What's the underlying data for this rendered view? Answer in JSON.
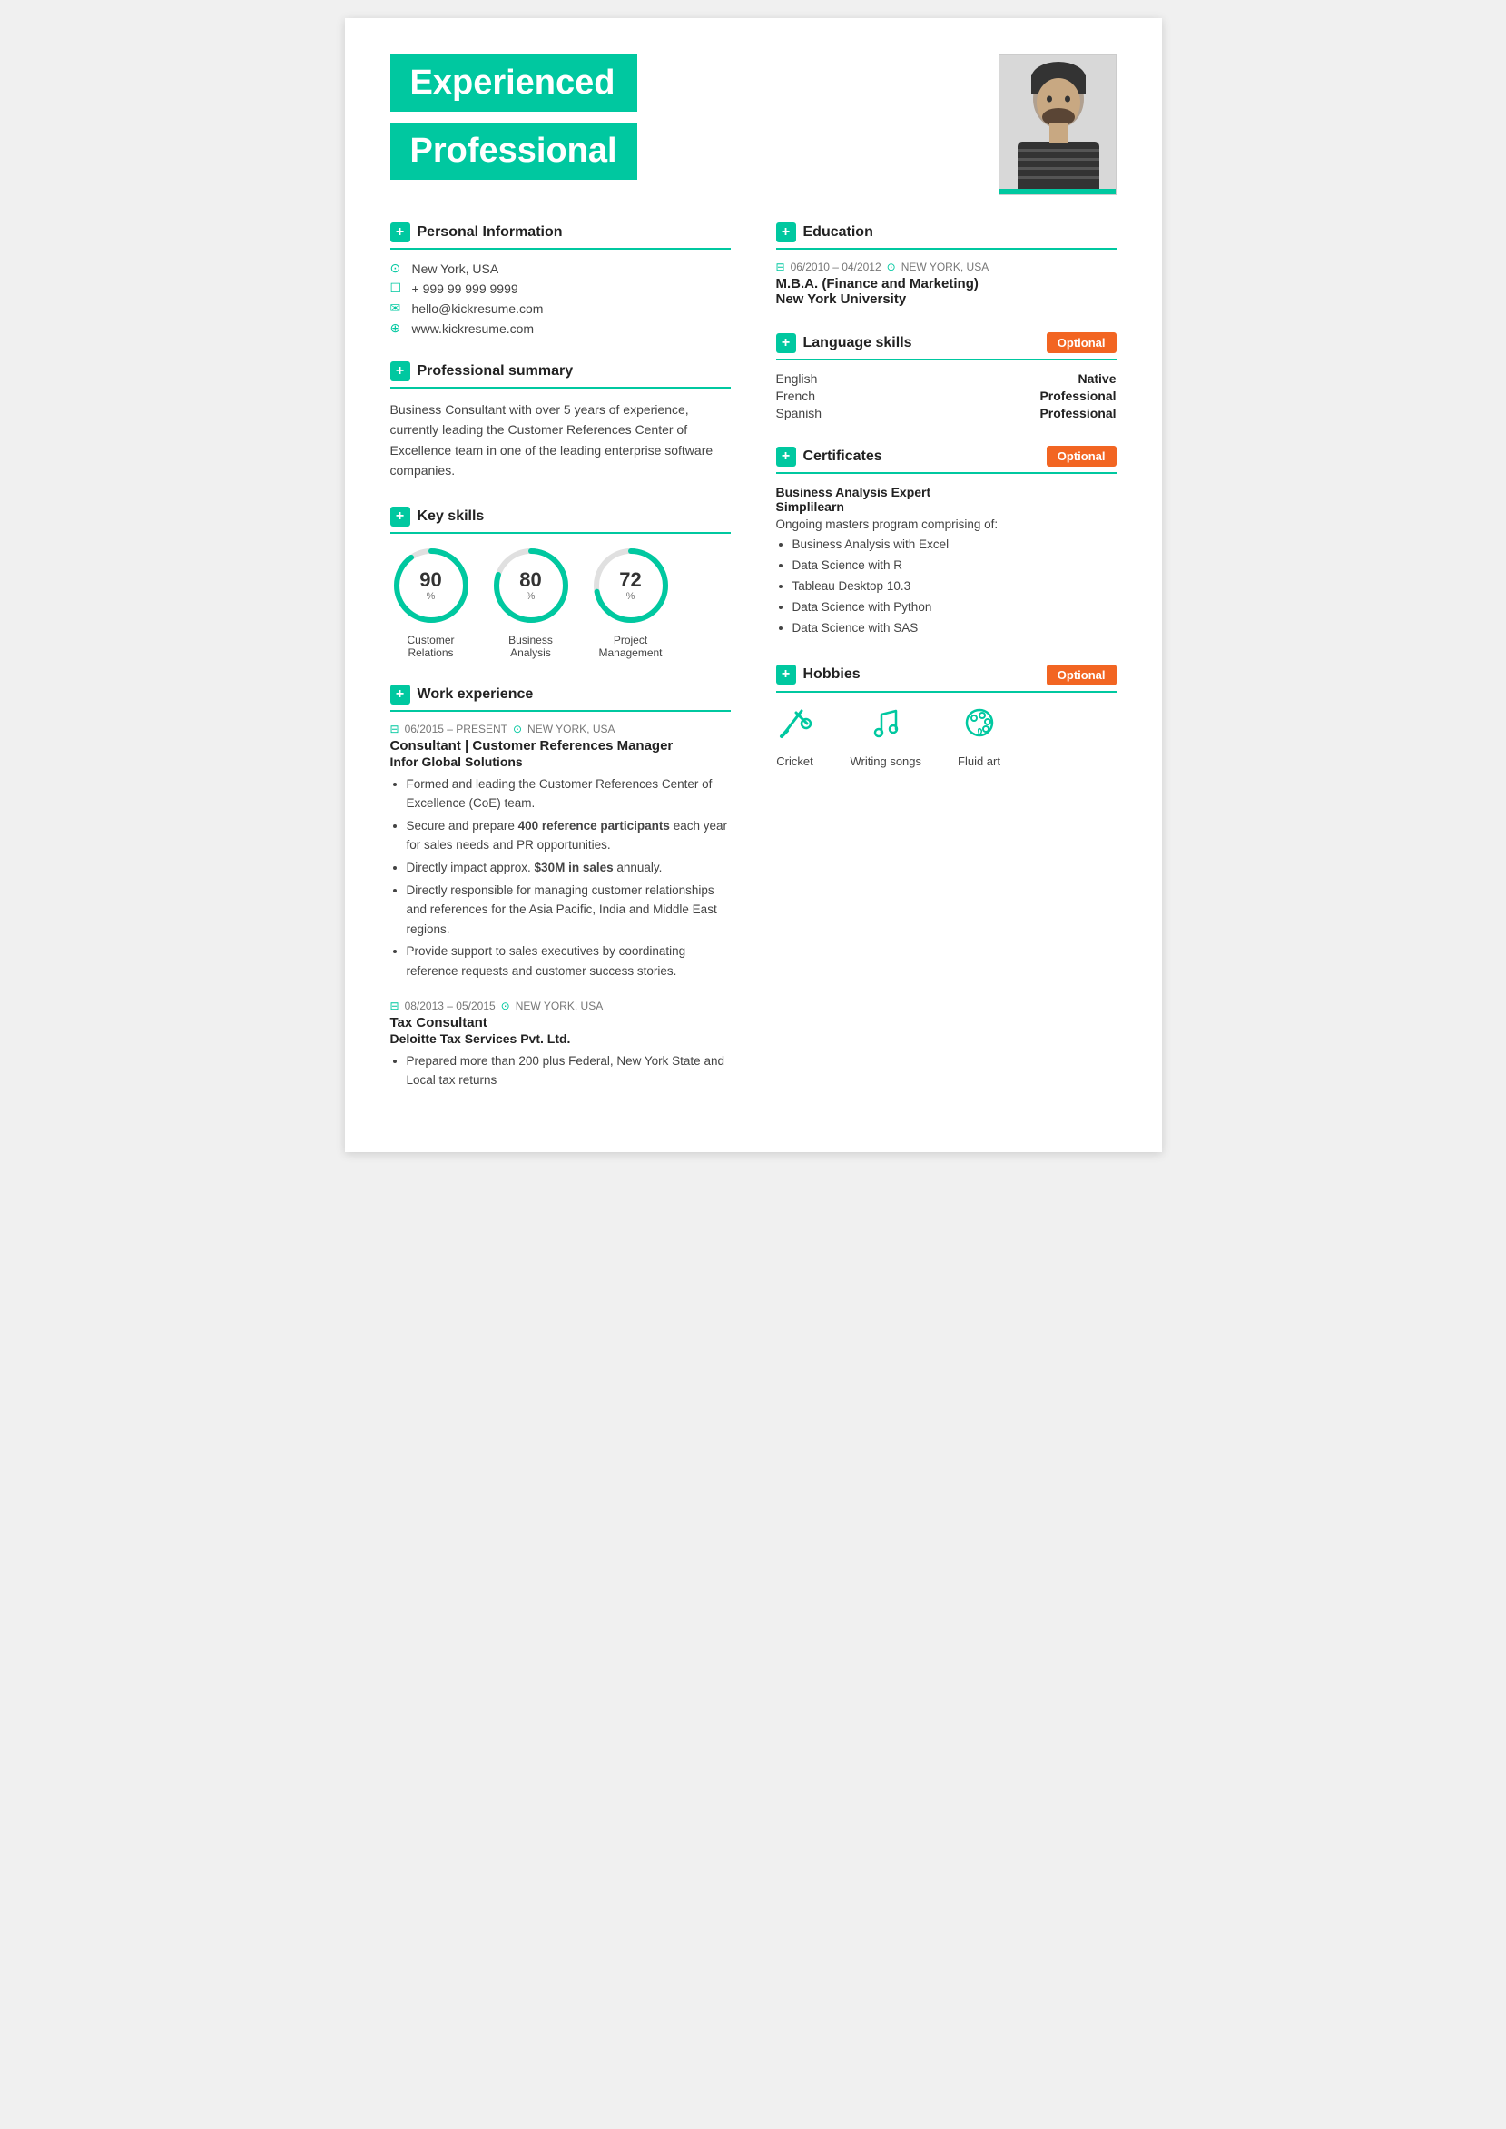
{
  "header": {
    "line1": "Experienced",
    "line2": "Professional"
  },
  "personal": {
    "section_title": "Personal Information",
    "location": "New York, USA",
    "phone": "+ 999 99 999 9999",
    "email": "hello@kickresume.com",
    "website": "www.kickresume.com"
  },
  "summary": {
    "section_title": "Professional summary",
    "text": "Business Consultant with over 5 years of experience, currently leading the Customer References Center of Excellence team in one of the leading enterprise software companies."
  },
  "skills": {
    "section_title": "Key skills",
    "items": [
      {
        "value": 90,
        "label": "Customer\nRelations"
      },
      {
        "value": 80,
        "label": "Business\nAnalysis"
      },
      {
        "value": 72,
        "label": "Project\nManagement"
      }
    ]
  },
  "work": {
    "section_title": "Work experience",
    "jobs": [
      {
        "date": "06/2015 – PRESENT",
        "location": "NEW YORK, USA",
        "title": "Consultant | Customer References Manager",
        "company": "Infor Global Solutions",
        "bullets": [
          "Formed and leading the Customer References Center of Excellence (CoE) team.",
          "Secure and prepare 400 reference participants each year for sales needs and PR opportunities.",
          "Directly impact approx. $30M in sales annualy.",
          "Directly responsible for managing customer relationships and references for the Asia Pacific, India and Middle East regions.",
          "Provide support to sales executives by coordinating reference requests and customer success stories."
        ],
        "bold_parts": [
          "400 reference participants",
          "$30M in sales"
        ]
      },
      {
        "date": "08/2013 – 05/2015",
        "location": "NEW YORK, USA",
        "title": "Tax Consultant",
        "company": "Deloitte Tax Services Pvt. Ltd.",
        "bullets": [
          "Prepared more than 200 plus Federal, New York State and Local tax returns"
        ]
      }
    ]
  },
  "education": {
    "section_title": "Education",
    "date": "06/2010 – 04/2012",
    "location": "NEW YORK, USA",
    "degree": "M.B.A. (Finance and Marketing)",
    "school": "New York University"
  },
  "languages": {
    "section_title": "Language skills",
    "optional": "Optional",
    "items": [
      {
        "name": "English",
        "level": "Native"
      },
      {
        "name": "French",
        "level": "Professional"
      },
      {
        "name": "Spanish",
        "level": "Professional"
      }
    ]
  },
  "certificates": {
    "section_title": "Certificates",
    "optional": "Optional",
    "title": "Business Analysis Expert",
    "org": "Simplilearn",
    "desc": "Ongoing masters program comprising of:",
    "bullets": [
      "Business Analysis with Excel",
      "Data Science with R",
      "Tableau Desktop 10.3",
      "Data Science with Python",
      "Data Science with SAS"
    ]
  },
  "hobbies": {
    "section_title": "Hobbies",
    "optional": "Optional",
    "items": [
      {
        "label": "Cricket",
        "icon": "🏏"
      },
      {
        "label": "Writing songs",
        "icon": "🎵"
      },
      {
        "label": "Fluid art",
        "icon": "🎨"
      }
    ]
  }
}
